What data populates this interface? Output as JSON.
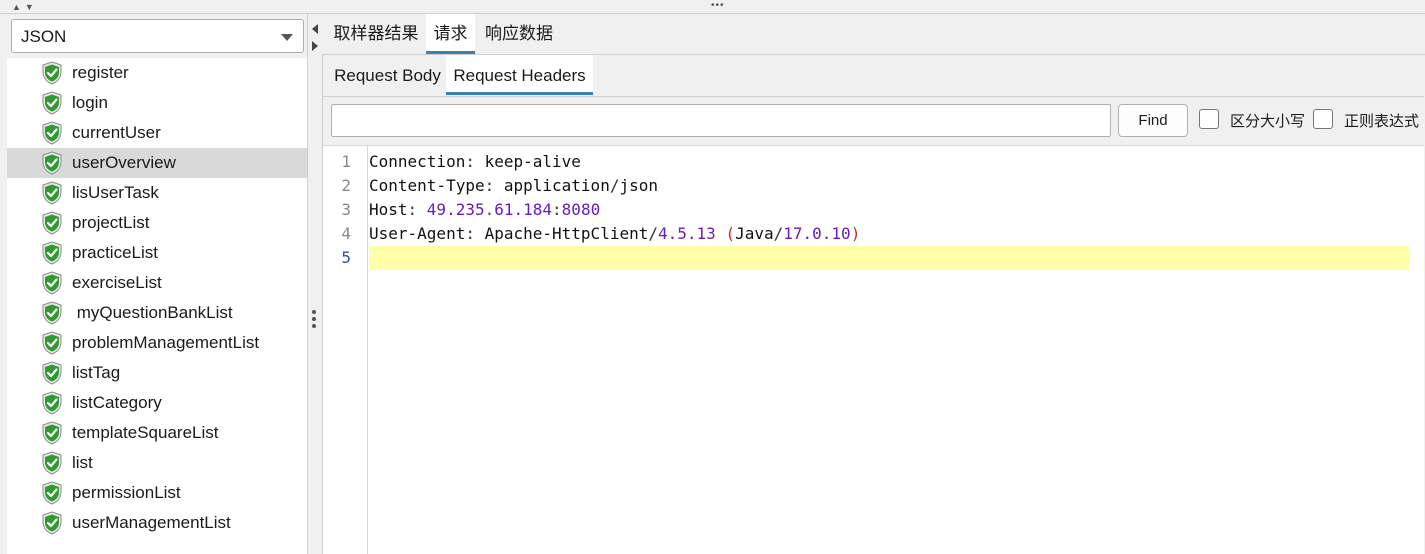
{
  "renderer": {
    "selected": "JSON"
  },
  "samplers": [
    {
      "label": "register",
      "status": "success"
    },
    {
      "label": "login",
      "status": "success"
    },
    {
      "label": "currentUser",
      "status": "success"
    },
    {
      "label": "userOverview",
      "status": "success",
      "selected": true
    },
    {
      "label": "lisUserTask",
      "status": "success"
    },
    {
      "label": "projectList",
      "status": "success"
    },
    {
      "label": "practiceList",
      "status": "success"
    },
    {
      "label": "exerciseList",
      "status": "success"
    },
    {
      "label": " myQuestionBankList",
      "status": "success"
    },
    {
      "label": "problemManagementList",
      "status": "success"
    },
    {
      "label": "listTag",
      "status": "success"
    },
    {
      "label": "listCategory",
      "status": "success"
    },
    {
      "label": "templateSquareList",
      "status": "success"
    },
    {
      "label": "list",
      "status": "success"
    },
    {
      "label": "permissionList",
      "status": "success"
    },
    {
      "label": "userManagementList",
      "status": "success"
    }
  ],
  "outer_tabs": [
    {
      "label": "取样器结果",
      "active": false
    },
    {
      "label": "请求",
      "active": true
    },
    {
      "label": "响应数据",
      "active": false
    }
  ],
  "inner_tabs": [
    {
      "label": "Request Body",
      "active": false
    },
    {
      "label": "Request Headers",
      "active": true
    }
  ],
  "search": {
    "value": "",
    "find_label": "Find",
    "case_sensitive_label": "区分大小写",
    "case_sensitive_checked": false,
    "regex_label": "正则表达式",
    "regex_checked": false
  },
  "editor": {
    "current_line": 5,
    "line_numbers": [
      "1",
      "2",
      "3",
      "4",
      "5"
    ],
    "lines": [
      {
        "key": "Connection",
        "sep": ": ",
        "value": "keep-alive"
      },
      {
        "key": "Content-Type",
        "sep": ": ",
        "value": "application/json"
      },
      {
        "key": "Host",
        "sep": ": ",
        "value": "49.235.61.184:8080"
      },
      {
        "key": "User-Agent",
        "sep": ": ",
        "value": "Apache-HttpClient/4.5.13 (Java/17.0.10)"
      },
      {
        "key": "",
        "sep": "",
        "value": ""
      }
    ]
  },
  "colors": {
    "success_icon": "#2e9b2e",
    "selection": "#d9d9d9",
    "active_tab_underline": "#3c7fb1",
    "current_line": "#ffffaa",
    "number_token": "#6a1bbf",
    "paren_token": "#cc2b2b"
  },
  "icons": {
    "sampler_status": "shield-check-icon",
    "dropdown": "chevron-down-icon"
  }
}
